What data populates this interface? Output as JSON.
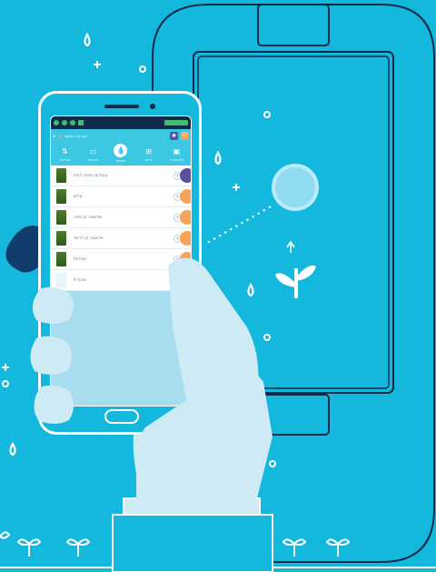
{
  "colors": {
    "background": "#13b8dc",
    "navy": "#0f2a4a",
    "white": "#ffffff",
    "hand": "#cdeaf5",
    "orange": "#f7a45b",
    "purple": "#5a4f9e"
  },
  "app": {
    "title": "מערכת השקיה",
    "buttons": {
      "settings_icon": "gear-icon",
      "power_icon": "power-icon"
    }
  },
  "tabs": [
    {
      "label": "הגדרות",
      "icon": "settings-icon"
    },
    {
      "label": "תוכניות",
      "icon": "calendar-icon"
    },
    {
      "label": "השקיה",
      "icon": "drop-icon"
    },
    {
      "label": "ברזים",
      "icon": "valve-icon"
    },
    {
      "label": "לוח בקרה",
      "icon": "dashboard-icon"
    }
  ],
  "zones": [
    {
      "label": "עמודים כניסה לבית",
      "pill_color": "#5a4f9e"
    },
    {
      "label": "קדים",
      "pill_color": "#f7a45b"
    },
    {
      "label": "מדשאה קו מפר",
      "pill_color": "#f7a45b"
    },
    {
      "label": "מדשאה קו דרומי",
      "pill_color": "#f7a45b"
    },
    {
      "label": "תגוליות",
      "pill_color": "#f7a45b"
    },
    {
      "label": "מגוף 6",
      "pill_color": ""
    }
  ]
}
